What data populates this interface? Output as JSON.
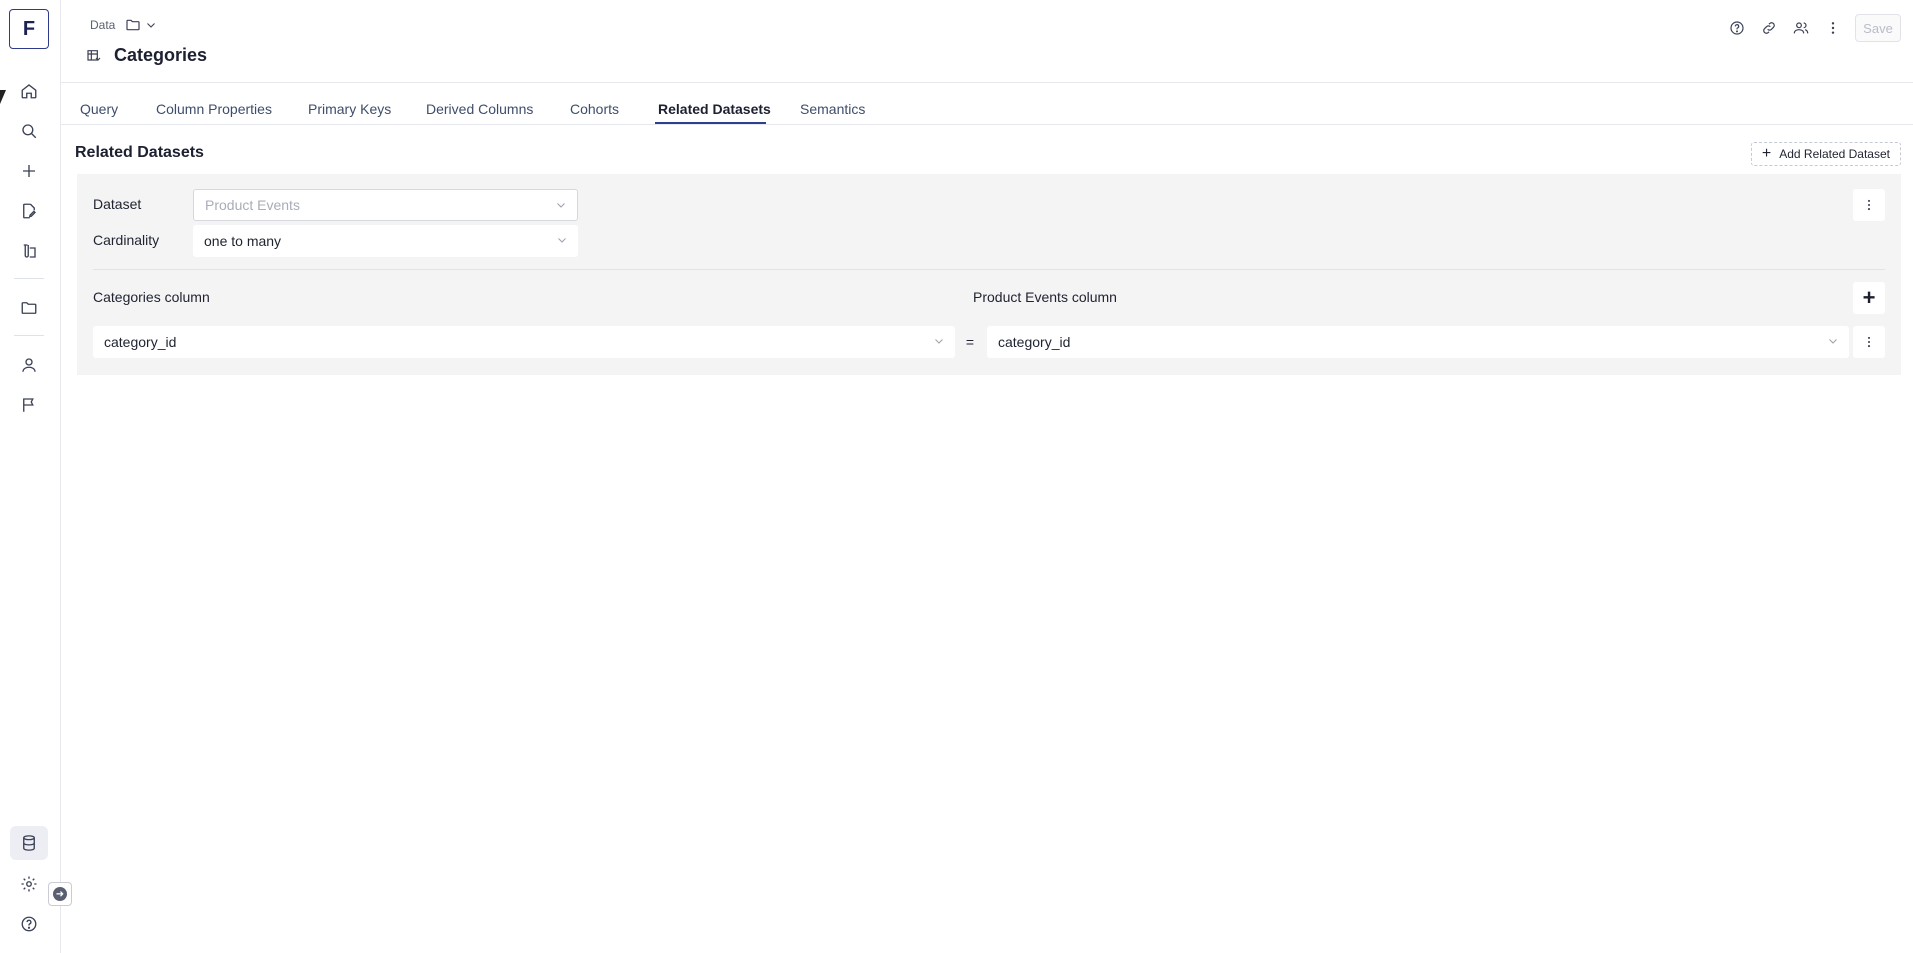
{
  "sidebar": {
    "logo_letter": "F",
    "nav_icons": [
      "home-icon",
      "search-icon",
      "plus-icon",
      "file-edit-icon",
      "lab-icon",
      "folder-icon",
      "user-icon",
      "flag-icon"
    ],
    "bottom_icons": [
      "database-icon",
      "gear-icon",
      "help-icon"
    ],
    "expand_icon": "arrow-right-icon"
  },
  "header": {
    "breadcrumb_label": "Data",
    "title": "Categories",
    "save_label": "Save"
  },
  "tabs": [
    {
      "label": "Query"
    },
    {
      "label": "Column Properties"
    },
    {
      "label": "Primary Keys"
    },
    {
      "label": "Derived Columns"
    },
    {
      "label": "Cohorts"
    },
    {
      "label": "Related Datasets"
    },
    {
      "label": "Semantics"
    }
  ],
  "active_tab": "Related Datasets",
  "main": {
    "section_title": "Related Datasets",
    "add_button_label": "Add Related Dataset",
    "relation": {
      "dataset_label": "Dataset",
      "dataset_value": "Product Events",
      "cardinality_label": "Cardinality",
      "cardinality_value": "one to many",
      "left_column_header": "Categories column",
      "right_column_header": "Product Events column",
      "left_column_value": "category_id",
      "operator": "=",
      "right_column_value": "category_id"
    }
  },
  "colors": {
    "accent": "#2d3f8f",
    "panel_bg": "#f4f4f5"
  }
}
